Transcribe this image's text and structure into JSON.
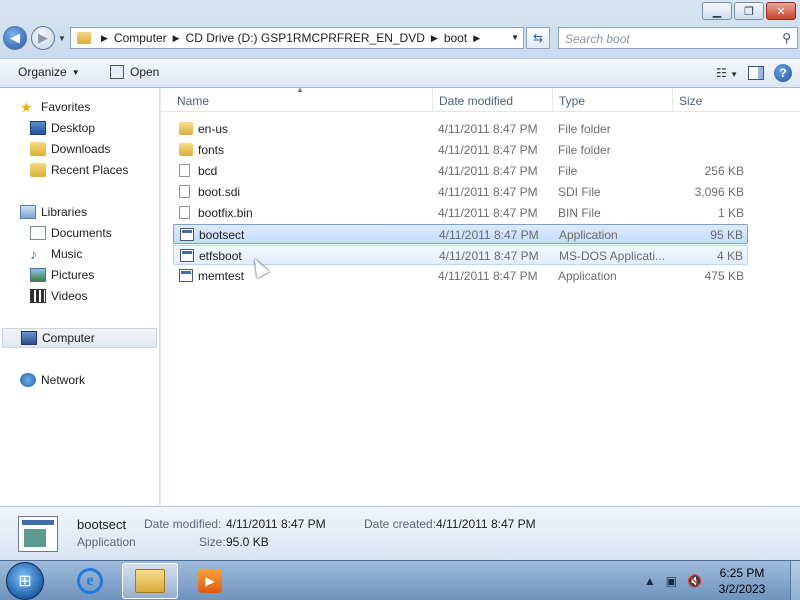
{
  "window": {
    "controls": {
      "minimize": "▁",
      "maximize": "❐",
      "close": "✕"
    }
  },
  "address": {
    "crumbs": [
      "Computer",
      "CD Drive (D:) GSP1RMCPRFRER_EN_DVD",
      "boot"
    ]
  },
  "search": {
    "placeholder": "Search boot"
  },
  "toolbar": {
    "organize": "Organize",
    "open": "Open"
  },
  "nav": {
    "favorites": "Favorites",
    "desktop": "Desktop",
    "downloads": "Downloads",
    "recent": "Recent Places",
    "libraries": "Libraries",
    "documents": "Documents",
    "music": "Music",
    "pictures": "Pictures",
    "videos": "Videos",
    "computer": "Computer",
    "network": "Network"
  },
  "columns": {
    "name": "Name",
    "date": "Date modified",
    "type": "Type",
    "size": "Size"
  },
  "files": [
    {
      "name": "en-us",
      "date": "4/11/2011 8:47 PM",
      "type": "File folder",
      "size": "",
      "icon": "folder-icon"
    },
    {
      "name": "fonts",
      "date": "4/11/2011 8:47 PM",
      "type": "File folder",
      "size": "",
      "icon": "folder-icon"
    },
    {
      "name": "bcd",
      "date": "4/11/2011 8:47 PM",
      "type": "File",
      "size": "256 KB",
      "icon": "file-icon"
    },
    {
      "name": "boot.sdi",
      "date": "4/11/2011 8:47 PM",
      "type": "SDI File",
      "size": "3,096 KB",
      "icon": "file-icon"
    },
    {
      "name": "bootfix.bin",
      "date": "4/11/2011 8:47 PM",
      "type": "BIN File",
      "size": "1 KB",
      "icon": "file-icon"
    },
    {
      "name": "bootsect",
      "date": "4/11/2011 8:47 PM",
      "type": "Application",
      "size": "95 KB",
      "icon": "application-icon"
    },
    {
      "name": "etfsboot",
      "date": "4/11/2011 8:47 PM",
      "type": "MS-DOS Applicati...",
      "size": "4 KB",
      "icon": "application-icon"
    },
    {
      "name": "memtest",
      "date": "4/11/2011 8:47 PM",
      "type": "Application",
      "size": "475 KB",
      "icon": "application-icon"
    }
  ],
  "details": {
    "name": "bootsect",
    "type": "Application",
    "modified_label": "Date modified:",
    "modified": "4/11/2011 8:47 PM",
    "created_label": "Date created:",
    "created": "4/11/2011 8:47 PM",
    "size_label": "Size:",
    "size": "95.0 KB"
  },
  "taskbar": {
    "time": "6:25 PM",
    "date": "3/2/2023"
  }
}
